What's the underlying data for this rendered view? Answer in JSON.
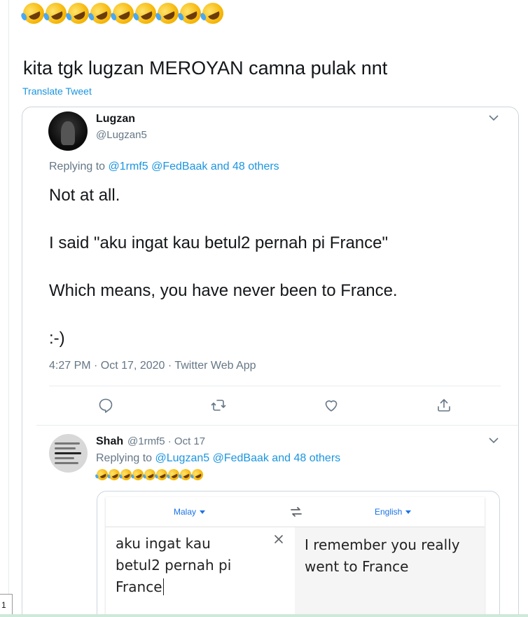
{
  "tweet": {
    "emoji_count": 9,
    "text": "kita tgk lugzan MEROYAN camna pulak nnt",
    "translate_label": "Translate Tweet"
  },
  "quoted": {
    "name": "Lugzan",
    "handle": "@Lugzan5",
    "replying_prefix": "Replying to",
    "replying_links": "@1rmf5 @FedBaak and 48 others",
    "lines": [
      "Not at all.",
      "I said \"aku ingat kau betul2 pernah pi France\"",
      "Which means, you have never been to France.",
      ":-)"
    ],
    "meta": "4:27 PM · Oct 17, 2020 · Twitter Web App",
    "actions": [
      "reply-icon",
      "retweet-icon",
      "like-icon",
      "share-icon"
    ]
  },
  "reply": {
    "name": "Shah",
    "handle_date": "@1rmf5 · Oct 17",
    "replying_prefix": "Replying to",
    "replying_links": "@Lugzan5 @FedBaak and 48 others",
    "emoji_count": 9
  },
  "translate_widget": {
    "source_lang": "Malay",
    "target_lang": "English",
    "source_text": [
      "aku ingat kau",
      "betul2 pernah pi",
      "France"
    ],
    "target_text": [
      "I remember you really",
      "went to France"
    ]
  },
  "page_number": "1",
  "colors": {
    "link": "#1b95e0",
    "muted": "#657786",
    "google_blue": "#1a73e8"
  }
}
